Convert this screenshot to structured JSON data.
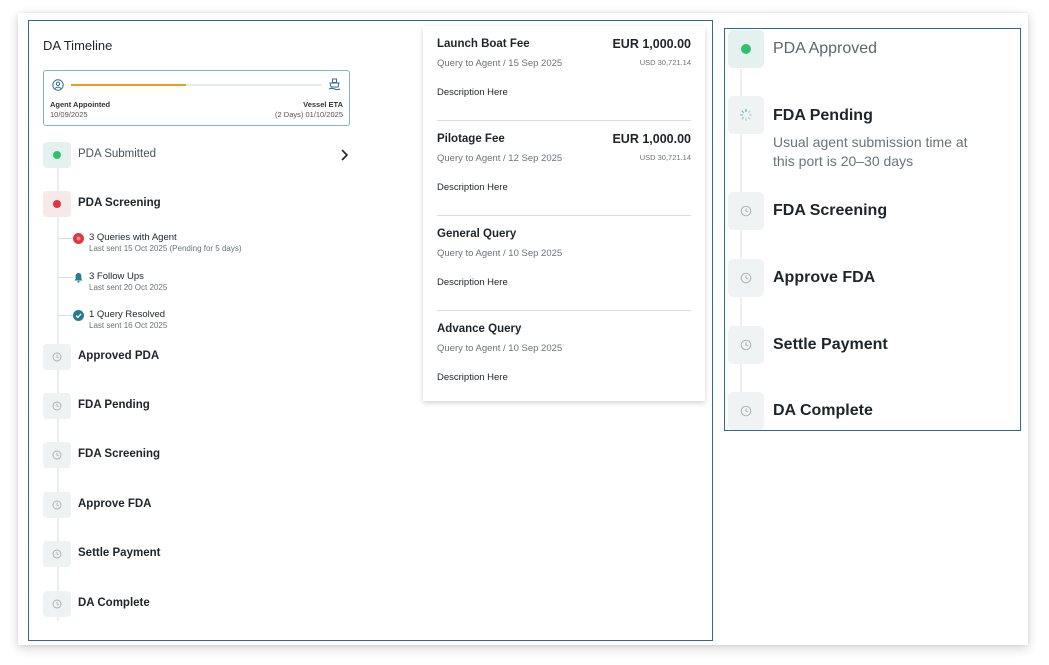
{
  "timeline": {
    "title": "DA Timeline",
    "progress": {
      "fraction": 0.46,
      "start_label": "Agent Appointed",
      "start_date": "10/09/2025",
      "end_label": "Vessel ETA",
      "end_date": "(2 Days) 01/10/2025",
      "fill_color": "#f39a1d"
    },
    "steps": [
      {
        "label": "PDA Submitted",
        "status": "complete",
        "icon": "green-dot"
      },
      {
        "label": "PDA Screening",
        "status": "active",
        "icon": "red-dot"
      },
      {
        "label": "Approved PDA",
        "status": "pending",
        "icon": "clock-icon"
      },
      {
        "label": "FDA Pending",
        "status": "pending",
        "icon": "clock-icon"
      },
      {
        "label": "FDA Screening",
        "status": "pending",
        "icon": "clock-icon"
      },
      {
        "label": "Approve FDA",
        "status": "pending",
        "icon": "clock-icon"
      },
      {
        "label": "Settle Payment",
        "status": "pending",
        "icon": "clock-icon"
      },
      {
        "label": "DA Complete",
        "status": "pending",
        "icon": "clock-icon"
      }
    ],
    "sub_items": [
      {
        "title": "3 Queries with Agent",
        "desc": "Last sent 15 Oct 2025 (Pending for 5 days)",
        "icon": "red-alert-icon"
      },
      {
        "title": "3 Follow Ups",
        "desc": "Last sent 20 Oct 2025",
        "icon": "bell-icon"
      },
      {
        "title": "1 Query Resolved",
        "desc": "Last sent 16 Oct 2025",
        "icon": "check-circle-icon"
      }
    ]
  },
  "queries": [
    {
      "title": "Launch Boat Fee",
      "amount": "EUR 1,000.00",
      "sub": "Query to Agent  /  15 Sep 2025",
      "usd": "USD 30,721.14",
      "desc": "Description Here"
    },
    {
      "title": "Pilotage Fee",
      "amount": "EUR 1,000.00",
      "sub": "Query to Agent  /  12 Sep 2025",
      "usd": "USD 30,721.14",
      "desc": "Description Here"
    },
    {
      "title": "General Query",
      "amount": "",
      "sub": "Query to Agent  /  10 Sep 2025",
      "usd": "",
      "desc": "Description Here"
    },
    {
      "title": "Advance Query",
      "amount": "",
      "sub": "Query to Agent  /  10 Sep 2025",
      "usd": "",
      "desc": "Description Here"
    }
  ],
  "right_timeline": {
    "steps": [
      {
        "label": "PDA Approved",
        "status": "complete",
        "icon": "green-dot"
      },
      {
        "label": "FDA Pending",
        "status": "active",
        "icon": "spinner-icon",
        "desc": "Usual agent submission time at this port is 20–30 days"
      },
      {
        "label": "FDA Screening",
        "status": "pending",
        "icon": "clock-icon"
      },
      {
        "label": "Approve FDA",
        "status": "pending",
        "icon": "clock-icon"
      },
      {
        "label": "Settle Payment",
        "status": "pending",
        "icon": "clock-icon"
      },
      {
        "label": "DA Complete",
        "status": "pending",
        "icon": "clock-icon"
      }
    ]
  },
  "colors": {
    "border": "#2d6d8a",
    "complete": "#2ec26b",
    "alert": "#e0373f",
    "progress": "#f39a1d",
    "resolved": "#2a7a94"
  }
}
